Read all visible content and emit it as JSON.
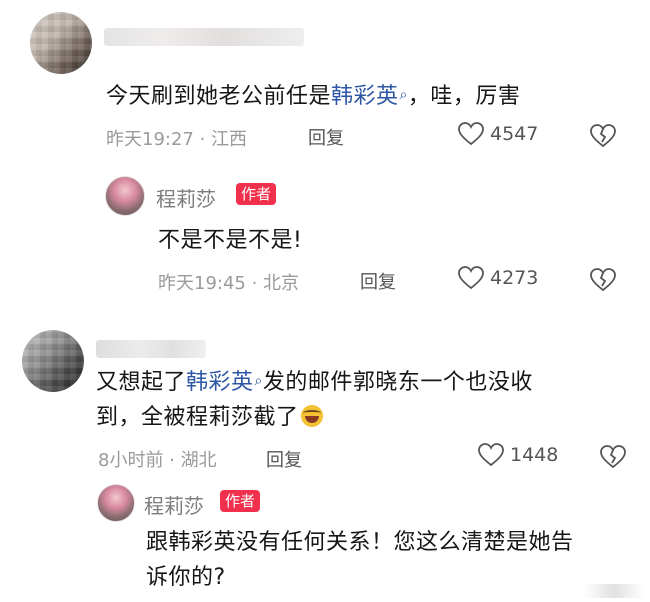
{
  "comments": [
    {
      "text_prefix": "今天刷到她老公前任是",
      "link": "韩彩英",
      "text_suffix": "，哇，厉害",
      "meta": "昨天19:27 · 江西",
      "reply_label": "回复",
      "likes": "4547",
      "author_reply": {
        "name": "程莉莎",
        "tag": "作者",
        "text": "不是不是不是!",
        "meta": "昨天19:45 · 北京",
        "reply_label": "回复",
        "likes": "4273"
      }
    },
    {
      "text_prefix": "又想起了",
      "link": "韩彩英",
      "text_line1_suffix": "发的邮件郭晓东一个也没收",
      "text_line2": "到，全被程莉莎截了",
      "meta": "8小时前 · 湖北",
      "reply_label": "回复",
      "likes": "1448",
      "author_reply": {
        "name": "程莉莎",
        "tag": "作者",
        "text_line1": "跟韩彩英没有任何关系！您这么清楚是她告",
        "text_line2": "诉你的?"
      }
    }
  ],
  "icons": {
    "search": "search-icon",
    "like": "heart-icon",
    "dislike": "broken-heart-icon",
    "emoji": "laughing-emoji-icon"
  },
  "colors": {
    "link": "#2e57a6",
    "author_tag": "#f0304c",
    "meta": "#9a9a9a"
  }
}
